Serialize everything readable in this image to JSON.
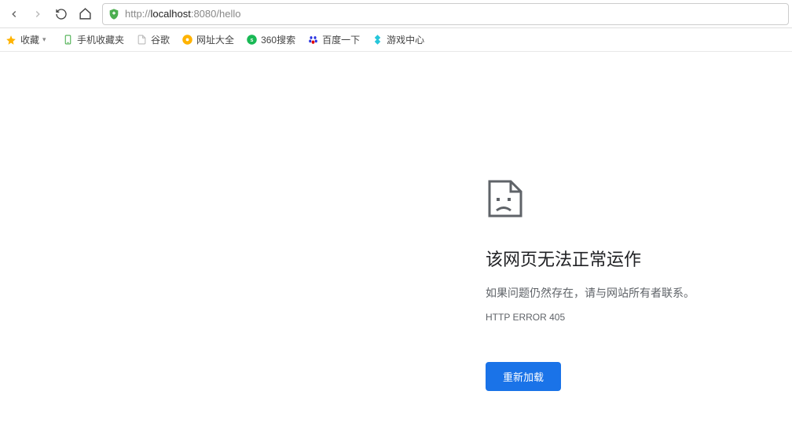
{
  "toolbar": {
    "url_prefix": "http://",
    "url_host": "localhost",
    "url_port": ":8080",
    "url_path": "/hello"
  },
  "bookmarks": {
    "items": [
      {
        "label": "收藏",
        "icon": "star"
      },
      {
        "label": "手机收藏夹",
        "icon": "phone"
      },
      {
        "label": "谷歌",
        "icon": "page"
      },
      {
        "label": "网址大全",
        "icon": "compass"
      },
      {
        "label": "360搜索",
        "icon": "360"
      },
      {
        "label": "百度一下",
        "icon": "baidu"
      },
      {
        "label": "游戏中心",
        "icon": "game"
      }
    ]
  },
  "error": {
    "title": "该网页无法正常运作",
    "message": "如果问题仍然存在，请与网站所有者联系。",
    "code": "HTTP ERROR 405",
    "button": "重新加载"
  }
}
